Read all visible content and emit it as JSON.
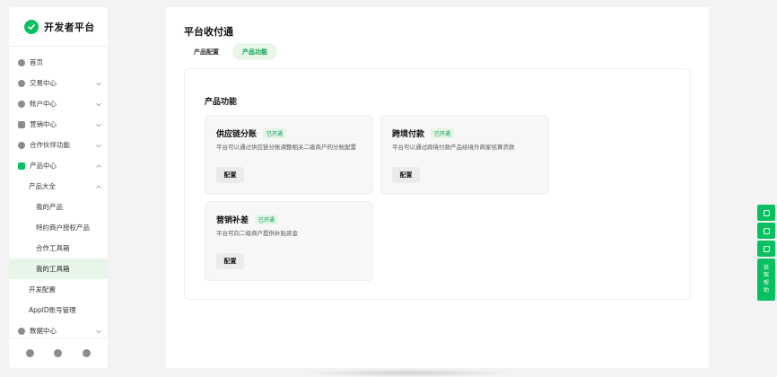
{
  "brand": {
    "title": "开发者平台",
    "logo_icon": "wechat-pay-check-icon",
    "accent": "#07c160"
  },
  "sidebar": {
    "items": [
      {
        "label": "首页",
        "icon": "home-icon",
        "level": 0
      },
      {
        "label": "交易中心",
        "icon": "trade-icon",
        "level": 0,
        "chevron": "down"
      },
      {
        "label": "账户中心",
        "icon": "account-icon",
        "level": 0,
        "chevron": "down"
      },
      {
        "label": "营销中心",
        "icon": "marketing-icon",
        "level": 0,
        "chevron": "down"
      },
      {
        "label": "合作伙伴功能",
        "icon": "partner-icon",
        "level": 0,
        "chevron": "down"
      },
      {
        "label": "产品中心",
        "icon": "product-icon",
        "level": 0,
        "chevron": "up"
      },
      {
        "label": "产品大全",
        "level": 1,
        "chevron": "up"
      },
      {
        "label": "我的产品",
        "level": 2
      },
      {
        "label": "特约商户授权产品",
        "level": 2
      },
      {
        "label": "合作工具箱",
        "level": 2
      },
      {
        "label": "我的工具箱",
        "level": 2,
        "active": true
      },
      {
        "label": "开发配置",
        "level": 1
      },
      {
        "label": "AppID账号管理",
        "level": 1
      },
      {
        "label": "数据中心",
        "icon": "data-icon",
        "level": 0,
        "chevron": "down"
      }
    ],
    "footer_icons": [
      "chat-icon",
      "bell-icon",
      "user-icon"
    ]
  },
  "main": {
    "title": "平台收付通",
    "tabs": [
      {
        "label": "产品配置",
        "active": false
      },
      {
        "label": "产品功能",
        "active": true
      }
    ],
    "panel_title": "产品功能",
    "cards": [
      {
        "title": "供应链分账",
        "badge": "已开通",
        "desc": "平台可以通过供应链分账调整相关二级商户的分账配置",
        "button": "配置"
      },
      {
        "title": "跨境付款",
        "badge": "已开通",
        "desc": "平台可以通过跨境付款产品给境外商家结算货款",
        "button": "配置"
      },
      {
        "title": "营销补差",
        "badge": "已开通",
        "desc": "平台可向二级商户提供补贴资金",
        "button": "配置"
      }
    ]
  },
  "float_bar": {
    "icons": [
      "link-icon",
      "download-icon",
      "edit-icon"
    ],
    "help_label": [
      "获",
      "取",
      "帮",
      "助"
    ]
  }
}
